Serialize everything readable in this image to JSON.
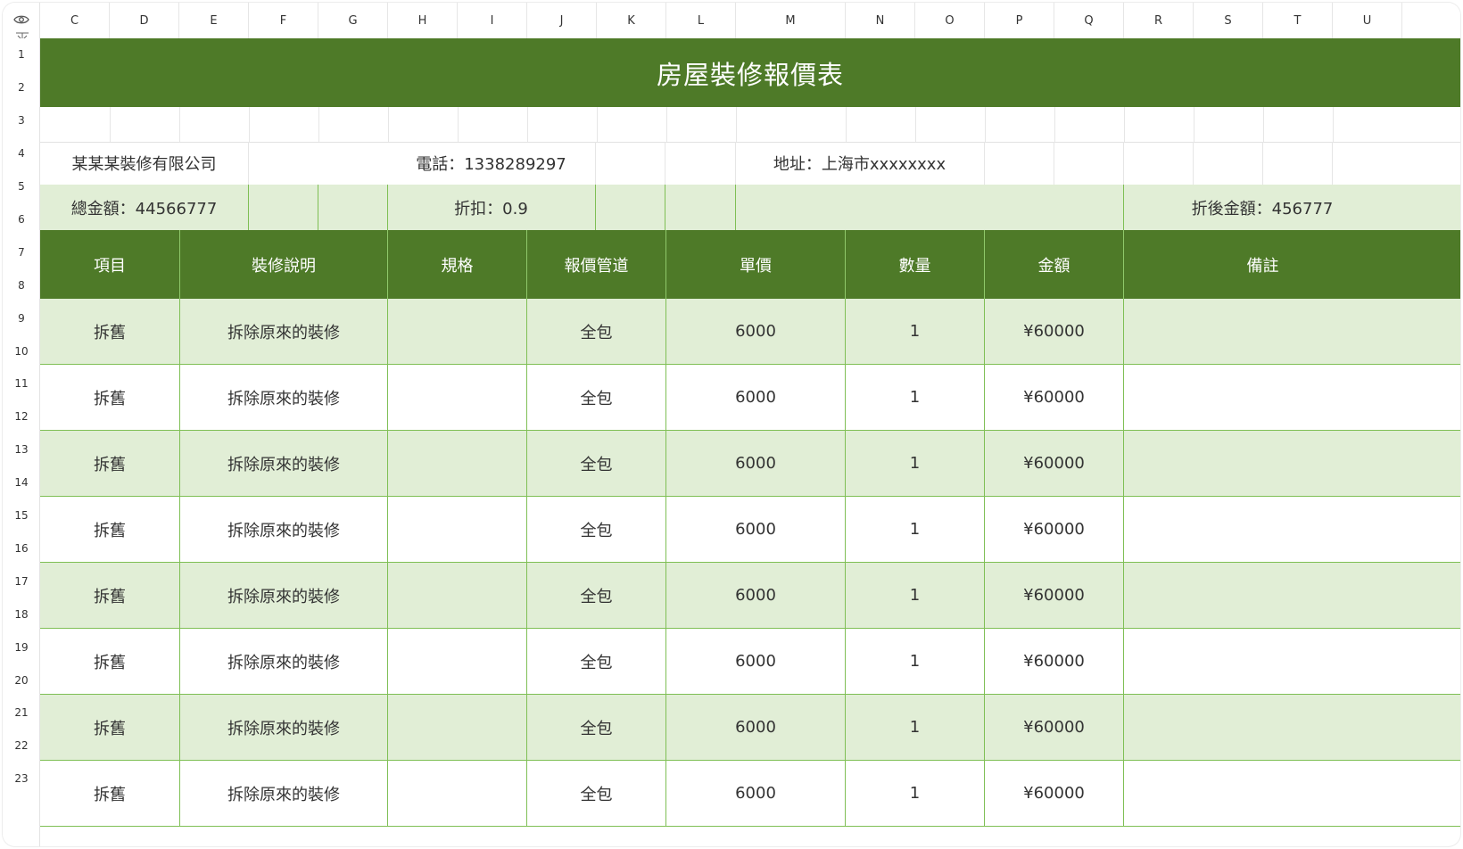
{
  "sheet": {
    "title": "房屋裝修報價表",
    "columns": [
      "C",
      "D",
      "E",
      "F",
      "G",
      "H",
      "I",
      "J",
      "K",
      "L",
      "M",
      "N",
      "O",
      "P",
      "Q",
      "R",
      "S",
      "T",
      "U"
    ],
    "rows": [
      "1",
      "2",
      "3",
      "4",
      "5",
      "6",
      "7",
      "8",
      "9",
      "10",
      "11",
      "12",
      "13",
      "14",
      "15",
      "16",
      "17",
      "18",
      "19",
      "20",
      "21",
      "22",
      "23"
    ],
    "info": {
      "company": "某某某裝修有限公司",
      "phone": "電話：1338289297",
      "address": "地址：上海市xxxxxxxx",
      "total": "總金額：44566777",
      "discount": "折扣：0.9",
      "discounted_total": "折後金額：456777"
    },
    "headers": [
      "項目",
      "裝修說明",
      "規格",
      "報價管道",
      "單價",
      "數量",
      "金額",
      "備註"
    ],
    "items": [
      {
        "item": "拆舊",
        "desc": "拆除原來的裝修",
        "spec": "",
        "channel": "全包",
        "price": "6000",
        "qty": "1",
        "amount": "¥60000",
        "note": ""
      },
      {
        "item": "拆舊",
        "desc": "拆除原來的裝修",
        "spec": "",
        "channel": "全包",
        "price": "6000",
        "qty": "1",
        "amount": "¥60000",
        "note": ""
      },
      {
        "item": "拆舊",
        "desc": "拆除原來的裝修",
        "spec": "",
        "channel": "全包",
        "price": "6000",
        "qty": "1",
        "amount": "¥60000",
        "note": ""
      },
      {
        "item": "拆舊",
        "desc": "拆除原來的裝修",
        "spec": "",
        "channel": "全包",
        "price": "6000",
        "qty": "1",
        "amount": "¥60000",
        "note": ""
      },
      {
        "item": "拆舊",
        "desc": "拆除原來的裝修",
        "spec": "",
        "channel": "全包",
        "price": "6000",
        "qty": "1",
        "amount": "¥60000",
        "note": ""
      },
      {
        "item": "拆舊",
        "desc": "拆除原來的裝修",
        "spec": "",
        "channel": "全包",
        "price": "6000",
        "qty": "1",
        "amount": "¥60000",
        "note": ""
      },
      {
        "item": "拆舊",
        "desc": "拆除原來的裝修",
        "spec": "",
        "channel": "全包",
        "price": "6000",
        "qty": "1",
        "amount": "¥60000",
        "note": ""
      },
      {
        "item": "拆舊",
        "desc": "拆除原來的裝修",
        "spec": "",
        "channel": "全包",
        "price": "6000",
        "qty": "1",
        "amount": "¥60000",
        "note": ""
      }
    ]
  },
  "colors": {
    "header_green": "#4e7a28",
    "row_shade": "#e1eed6",
    "border_green": "#7fbf55"
  },
  "icons": {
    "top_left": "eye-icon",
    "freeze": "freeze-pane-icon"
  }
}
